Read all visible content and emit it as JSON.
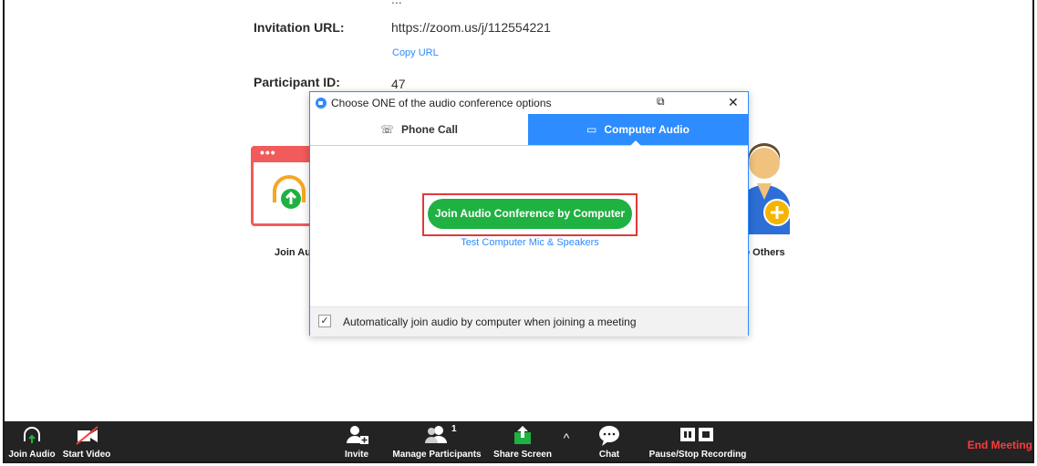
{
  "meeting": {
    "top_cut_text": "...",
    "invitation_label": "Invitation URL:",
    "invitation_value": "https://zoom.us/j/112554221",
    "copy_url": "Copy URL",
    "participant_label": "Participant ID:",
    "participant_value": "47"
  },
  "background_options": {
    "left_label": "Join Au",
    "right_label": "e Others"
  },
  "dialog": {
    "title": "Choose ONE of the audio conference options",
    "tabs": [
      {
        "label": "Phone Call",
        "icon": "phone-icon",
        "selected": false
      },
      {
        "label": "Computer Audio",
        "icon": "laptop-icon",
        "selected": true
      }
    ],
    "join_button": "Join Audio Conference by Computer",
    "test_link": "Test Computer Mic & Speakers",
    "auto_join_label": "Automatically join audio by computer when joining a meeting",
    "auto_join_checked": true,
    "accent_color": "#2d8cff",
    "join_color": "#1fb141"
  },
  "toolbar": {
    "join_audio": "Join Audio",
    "start_video": "Start Video",
    "invite": "Invite",
    "manage_participants": "Manage Participants",
    "participant_count": "1",
    "share_screen": "Share Screen",
    "chat": "Chat",
    "pause_stop_recording": "Pause/Stop Recording",
    "end_meeting": "End Meeting",
    "end_color": "#ff3b3b"
  }
}
